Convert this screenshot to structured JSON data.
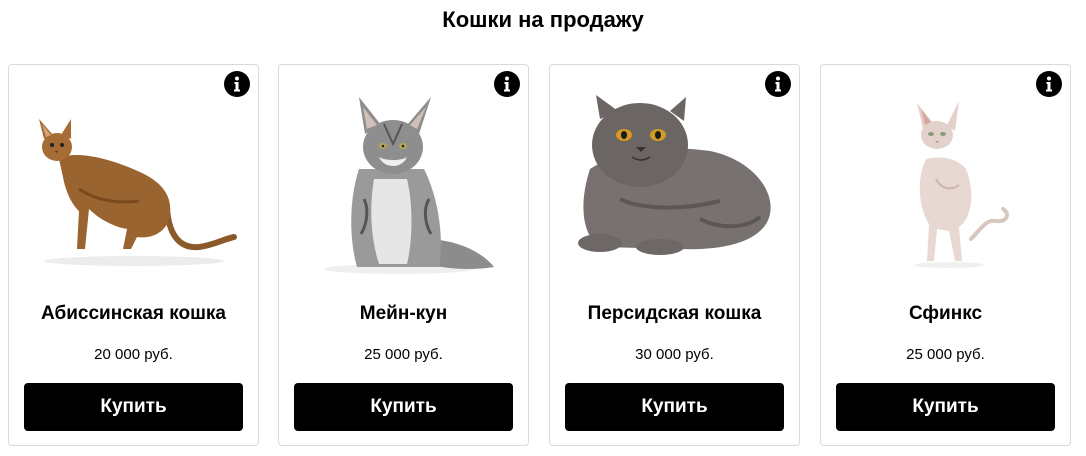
{
  "page": {
    "title": "Кошки на продажу"
  },
  "colors": {
    "button_bg": "#000000",
    "button_text": "#ffffff",
    "card_border": "#dadada"
  },
  "cards": [
    {
      "name": "Абиссинская кошка",
      "price": "20 000 руб.",
      "buy_label": "Купить",
      "image": "abyssinian-cat-photo",
      "info_icon": "info-icon"
    },
    {
      "name": "Мейн-кун",
      "price": "25 000 руб.",
      "buy_label": "Купить",
      "image": "maine-coon-cat-photo",
      "info_icon": "info-icon"
    },
    {
      "name": "Персидская кошка",
      "price": "30 000 руб.",
      "buy_label": "Купить",
      "image": "persian-cat-photo",
      "info_icon": "info-icon"
    },
    {
      "name": "Сфинкс",
      "price": "25 000 руб.",
      "buy_label": "Купить",
      "image": "sphynx-cat-photo",
      "info_icon": "info-icon"
    }
  ]
}
